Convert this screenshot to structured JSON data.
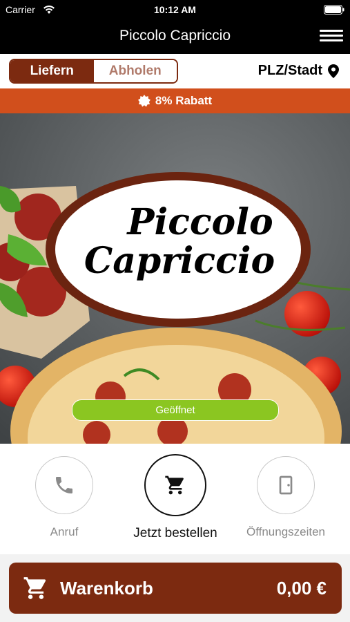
{
  "status_bar": {
    "carrier": "Carrier",
    "time": "10:12 AM"
  },
  "navbar": {
    "title": "Piccolo Capriccio",
    "menu_icon": "hamburger-menu-icon"
  },
  "delivery": {
    "options": [
      "Liefern",
      "Abholen"
    ],
    "selected": "Liefern",
    "location_label": "PLZ/Stadt",
    "location_icon": "map-pin-icon"
  },
  "promo": {
    "text": "8% Rabatt",
    "icon": "badge-icon",
    "color": "#d14f1c"
  },
  "hero": {
    "logo_line1": "Piccolo",
    "logo_line2": "Capriccio",
    "status_badge": "Geöffnet",
    "status_color": "#8bc621"
  },
  "actions": [
    {
      "label": "Anruf",
      "icon": "phone-icon"
    },
    {
      "label": "Jetzt bestellen",
      "icon": "shopping-cart-icon"
    },
    {
      "label": "Öffnungszeiten",
      "icon": "door-icon"
    }
  ],
  "cart": {
    "label": "Warenkorb",
    "amount": "0,00 €",
    "icon": "shopping-cart-icon"
  },
  "colors": {
    "brand": "#7c2a10",
    "accent": "#d14f1c",
    "open": "#8bc621"
  }
}
